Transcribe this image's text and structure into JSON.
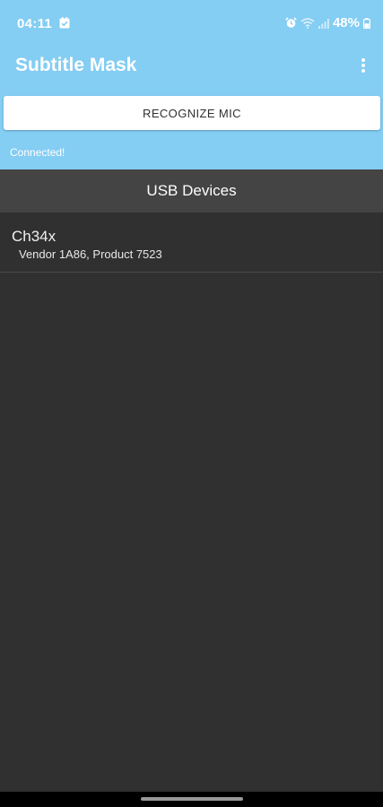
{
  "status_bar": {
    "time": "04:11",
    "battery": "48%",
    "icons": [
      "notification-icon",
      "alarm-icon",
      "wifi-icon",
      "signal-icon",
      "battery-icon"
    ]
  },
  "app_bar": {
    "title": "Subtitle Mask",
    "overflow_icon": "more-vert-icon"
  },
  "actions": {
    "recognize_label": "RECOGNIZE MIC"
  },
  "connection": {
    "status": "Connected!"
  },
  "usb_section": {
    "header": "USB Devices",
    "devices": [
      {
        "name": "Ch34x",
        "detail": "Vendor 1A86, Product 7523"
      }
    ]
  },
  "colors": {
    "app_bar_bg": "#84cdf3",
    "screen_bg": "#303030",
    "section_header_bg": "#444444",
    "button_bg": "#ffffff"
  }
}
